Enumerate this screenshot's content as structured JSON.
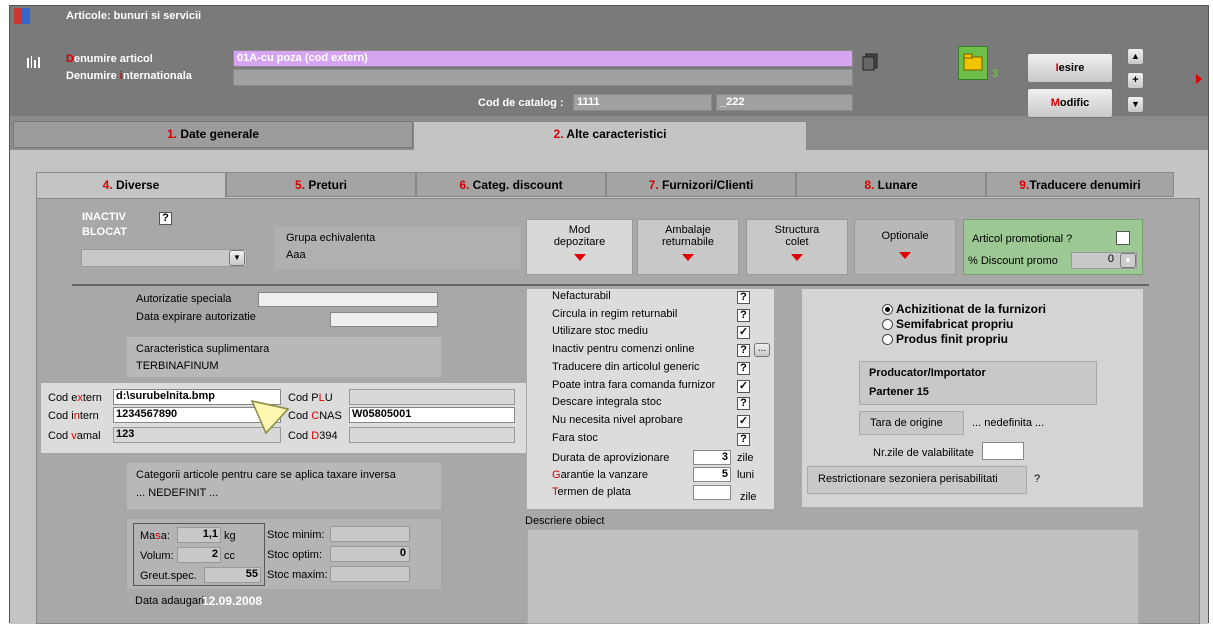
{
  "window": {
    "title": "Articole: bunuri si servicii"
  },
  "header": {
    "denumire_label_first": "D",
    "denumire_label_rest": "enumire articol",
    "denumire_value": "01A-cu poza (cod extern)",
    "internationala_label_a": "Denumire ",
    "internationala_label_b": "i",
    "internationala_label_c": "nternationala",
    "cod_catalog_label": "Cod de catalog :",
    "cod_catalog_value": "1111",
    "cod_catalog_suffix": "_222",
    "folder_count": "3",
    "iesire_first": "I",
    "iesire_rest": "esire",
    "modific_first": "M",
    "modific_rest": "odific"
  },
  "main_tabs": [
    {
      "num": "1.",
      "label": " Date generale"
    },
    {
      "num": "2.",
      "label": " Alte caracteristici"
    }
  ],
  "sub_tabs": [
    {
      "num": "4.",
      "label": " Diverse"
    },
    {
      "num": "5.",
      "label": " Preturi"
    },
    {
      "num": "6.",
      "label": " Categ. discount"
    },
    {
      "num": "7.",
      "label": " Furnizori/Clienti"
    },
    {
      "num": "8.",
      "label": " Lunare"
    },
    {
      "num": "9.",
      "label": "Traducere denumiri"
    }
  ],
  "top": {
    "inactiv": "INACTIV",
    "blocat": "BLOCAT",
    "question": "?",
    "grupa_label": "Grupa echivalenta",
    "grupa_value": "Aaa",
    "mod_depozitare": "Mod\ndepozitare",
    "ambalaje": "Ambalaje\nreturnabile",
    "structura": "Structura\ncolet",
    "optionale": "Optionale",
    "promo_label": "Articol promotional ?",
    "discount_label": "% Discount promo",
    "discount_value": "0"
  },
  "left": {
    "autorizatie": "Autorizatie speciala",
    "data_expirare": "Data expirare autorizatie",
    "caract_label": "Caracteristica suplimentara",
    "caract_value": "TERBINAFINUM",
    "cod_extern_label_a": "Cod e",
    "cod_extern_label_b": "x",
    "cod_extern_label_c": "tern",
    "cod_extern_value": "d:\\surubelnita.bmp",
    "cod_intern_label_a": "Cod i",
    "cod_intern_label_b": "n",
    "cod_intern_label_c": "tern",
    "cod_intern_value": "1234567890",
    "cod_vamal_label_a": "Cod ",
    "cod_vamal_label_b": "v",
    "cod_vamal_label_c": "amal",
    "cod_vamal_value": "123",
    "cod_plu_label_a": "Cod P",
    "cod_plu_label_b": "L",
    "cod_plu_label_c": "U",
    "cod_cnas_label_a": "Cod ",
    "cod_cnas_label_b": "C",
    "cod_cnas_label_c": "NAS",
    "cod_cnas_value": "W05805001",
    "cod_d394_label_a": "Cod ",
    "cod_d394_label_b": "D",
    "cod_d394_label_c": "394",
    "categorii_label": "Categorii articole pentru care se aplica taxare inversa",
    "categorii_value": "... NEDEFINIT ...",
    "masa_label_a": "Ma",
    "masa_label_b": "s",
    "masa_label_c": "a:",
    "masa_value": "1,1",
    "masa_unit": "kg",
    "volum_label": "Volum:",
    "volum_value": "2",
    "volum_unit": "cc",
    "greut_label": "Greut.spec.",
    "greut_value": "55",
    "stoc_minim": "Stoc minim:",
    "stoc_optim": "Stoc optim:",
    "stoc_optim_value": "0",
    "stoc_maxim": "Stoc maxim:",
    "data_adaugarii_label": "Data adaugarii",
    "data_adaugarii_value": "12.09.2008"
  },
  "middle": {
    "options": [
      {
        "label": "Nefacturabil",
        "state": "?"
      },
      {
        "label": "Circula in regim returnabil",
        "state": "?"
      },
      {
        "label": "Utilizare stoc mediu",
        "state": "✓"
      },
      {
        "label": "Inactiv pentru comenzi online",
        "state": "?"
      },
      {
        "label": "Traducere din articolul generic",
        "state": "?"
      },
      {
        "label": "Poate intra fara comanda furnizor",
        "state": "✓"
      },
      {
        "label": "Descare integrala stoc",
        "state": "?"
      },
      {
        "label": "Nu necesita nivel aprobare",
        "state": "✓"
      },
      {
        "label": "Fara stoc",
        "state": "?"
      }
    ],
    "more_btn": "...",
    "durata_label": "Durata de aprovizionare",
    "durata_value": "3",
    "durata_unit": "zile",
    "garantie_first": "G",
    "garantie_rest": "arantie la vanzare",
    "garantie_value": "5",
    "garantie_unit": "luni",
    "termen_first": "T",
    "termen_rest": "ermen de plata",
    "termen_unit": "zile",
    "descriere_label": "Descriere obiect"
  },
  "right": {
    "radio_1": "Achizitionat de la furnizori",
    "radio_2": "Semifabricat propriu",
    "radio_3": "Produs finit propriu",
    "producator_label": "Producator/Importator",
    "producator_value": "Partener 15",
    "tara_label": "Tara de origine",
    "tara_value": "... nedefinita ...",
    "nr_zile_label": "Nr.zile de valabilitate",
    "restrictionare_label": "Restrictionare sezoniera perisabilitati",
    "restrictionare_value": "?"
  },
  "colors": {
    "accent_red": "#d40000",
    "denumire_bg": "#d6a4f0",
    "promo_bg": "#9cc894"
  }
}
